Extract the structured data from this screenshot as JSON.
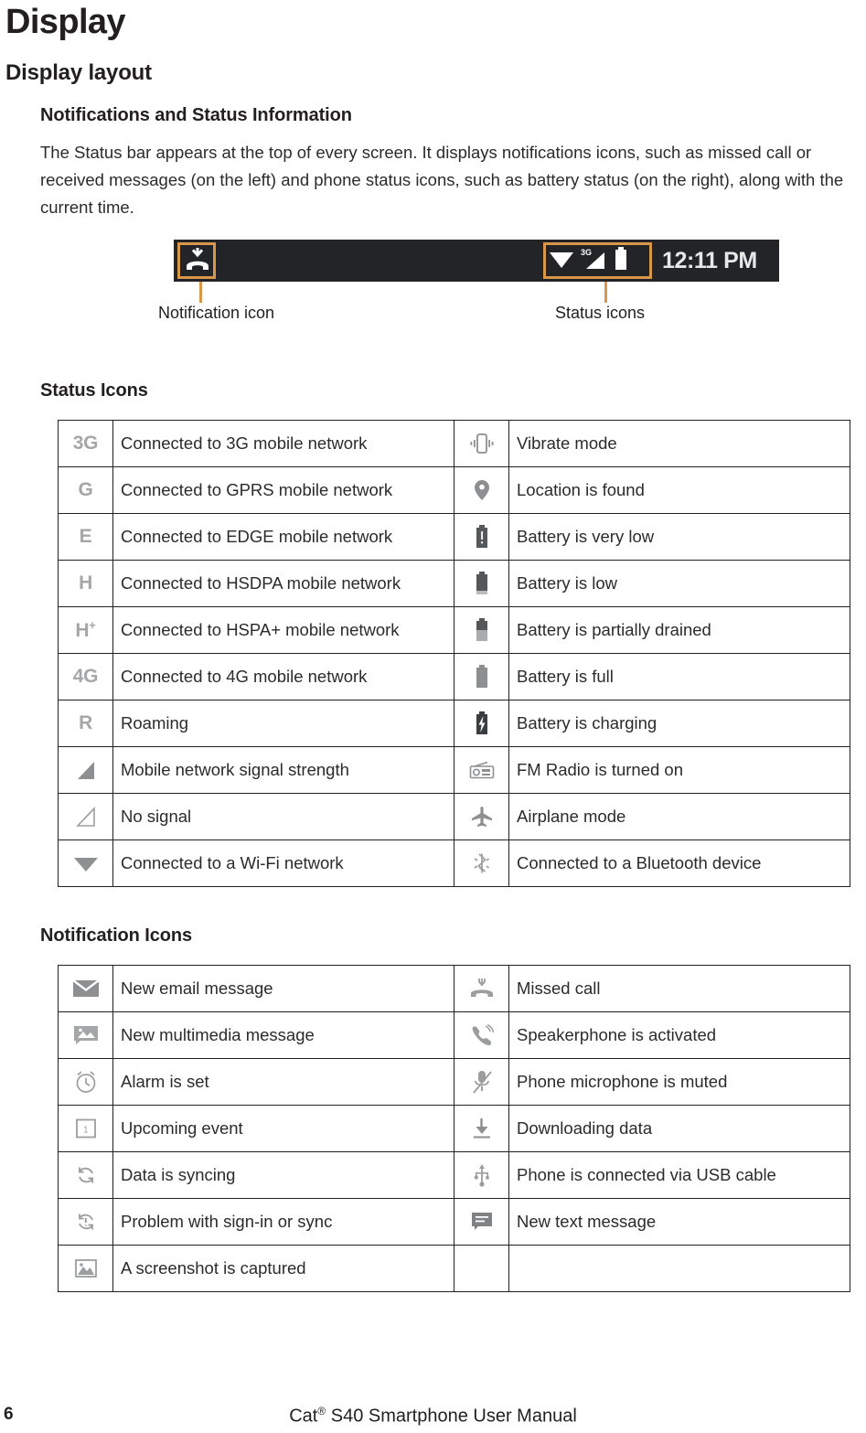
{
  "page": {
    "title": "Display",
    "section_heading": "Display layout",
    "subsection_heading": "Notifications and Status Information",
    "paragraph": "The Status bar appears at the top of every screen. It displays notifications icons, such as missed call or received messages (on the left) and phone status icons, such as battery status (on the right), along with the current time."
  },
  "figure": {
    "time": "12:11 PM",
    "caption_left": "Notification icon",
    "caption_right": "Status icons",
    "accent_color": "#d9974a",
    "bar_color": "#222428",
    "left_icon_name": "missed-call-icon",
    "right_icons": [
      "wifi-icon",
      "signal-3g-icon",
      "battery-icon"
    ]
  },
  "status_icons": {
    "heading": "Status Icons",
    "rows": [
      {
        "left_icon": "3G",
        "left_icon_name": "network-3g-icon",
        "left_text": "Connected to 3G mobile network",
        "right_icon_name": "vibrate-icon",
        "right_text": "Vibrate mode"
      },
      {
        "left_icon": "G",
        "left_icon_name": "network-gprs-icon",
        "left_text": "Connected to GPRS mobile network",
        "right_icon_name": "location-pin-icon",
        "right_text": "Location is found"
      },
      {
        "left_icon": "E",
        "left_icon_name": "network-edge-icon",
        "left_text": "Connected to EDGE mobile network",
        "right_icon_name": "battery-very-low-icon",
        "right_text": "Battery is very low"
      },
      {
        "left_icon": "H",
        "left_icon_name": "network-hsdpa-icon",
        "left_text": "Connected to HSDPA mobile network",
        "right_icon_name": "battery-low-icon",
        "right_text": "Battery is low"
      },
      {
        "left_icon": "H+",
        "left_icon_name": "network-hspa-plus-icon",
        "left_text": "Connected to HSPA+ mobile network",
        "right_icon_name": "battery-partial-icon",
        "right_text": "Battery is partially drained"
      },
      {
        "left_icon": "4G",
        "left_icon_name": "network-4g-icon",
        "left_text": "Connected to 4G mobile network",
        "right_icon_name": "battery-full-icon",
        "right_text": "Battery is full"
      },
      {
        "left_icon": "R",
        "left_icon_name": "roaming-icon",
        "left_text": "Roaming",
        "right_icon_name": "battery-charging-icon",
        "right_text": "Battery is charging"
      },
      {
        "left_icon": "",
        "left_icon_name": "signal-strength-icon",
        "left_text": "Mobile network signal strength",
        "right_icon_name": "fm-radio-icon",
        "right_text": "FM Radio is turned on"
      },
      {
        "left_icon": "",
        "left_icon_name": "no-signal-icon",
        "left_text": "No signal",
        "right_icon_name": "airplane-mode-icon",
        "right_text": "Airplane mode"
      },
      {
        "left_icon": "",
        "left_icon_name": "wifi-connected-icon",
        "left_text": "Connected to a Wi-Fi network",
        "right_icon_name": "bluetooth-icon",
        "right_text": "Connected to a Bluetooth device"
      }
    ]
  },
  "notification_icons": {
    "heading": "Notification Icons",
    "rows": [
      {
        "left_icon_name": "new-email-icon",
        "left_text": "New email message",
        "right_icon_name": "missed-call-icon",
        "right_text": "Missed call"
      },
      {
        "left_icon_name": "new-mms-icon",
        "left_text": "New multimedia message",
        "right_icon_name": "speakerphone-icon",
        "right_text": "Speakerphone is activated"
      },
      {
        "left_icon_name": "alarm-clock-icon",
        "left_text": "Alarm is set",
        "right_icon_name": "microphone-muted-icon",
        "right_text": "Phone microphone is muted"
      },
      {
        "left_icon_name": "calendar-event-icon",
        "left_text": "Upcoming event",
        "right_icon_name": "download-icon",
        "right_text": "Downloading data"
      },
      {
        "left_icon_name": "sync-icon",
        "left_text": "Data is syncing",
        "right_icon_name": "usb-icon",
        "right_text": "Phone is connected via USB cable"
      },
      {
        "left_icon_name": "sync-problem-icon",
        "left_text": "Problem with sign-in or sync",
        "right_icon_name": "sms-icon",
        "right_text": "New text message"
      },
      {
        "left_icon_name": "screenshot-icon",
        "left_text": "A screenshot is captured",
        "right_icon_name": "",
        "right_text": ""
      }
    ]
  },
  "footer": {
    "page_number": "6",
    "manual_title_pre": "Cat",
    "manual_title_sup": "®",
    "manual_title_post": " S40 Smartphone User Manual"
  }
}
